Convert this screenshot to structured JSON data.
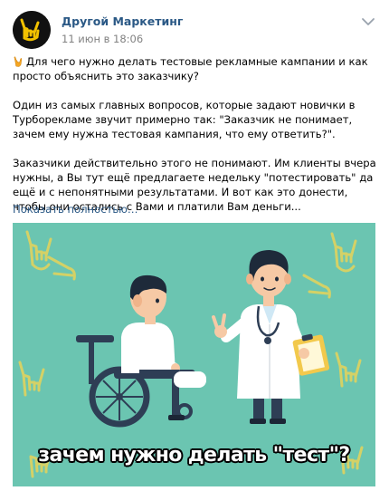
{
  "post": {
    "author": "Другой Маркетинг",
    "date": "11 июн в 18:06",
    "paragraphs": [
      "Для чего нужно делать тестовые рекламные кампании и как просто объяснить это заказчику?",
      "Один из самых главных вопросов, которые задают новички в Турборекламе звучит примерно так: \"Заказчик не понимает, зачем ему нужна тестовая кампания, что ему ответить?\".",
      "Заказчики действительно этого не понимают. Им клиенты вчера нужны, а Вы тут ещё предлагаете недельку \"потестировать\" да ещё и с непонятными результатами. И вот как это донести, чтобы они остались с Вами и платили Вам деньги..."
    ],
    "show_more": "Показать полностью…",
    "image_caption": "зачем нужно делать \"тест\"?"
  },
  "colors": {
    "link": "#2a5885",
    "muted": "#828282",
    "image_bg": "#6bc5b1",
    "doctor_coat": "#ffffff",
    "hair": "#1e2a3a"
  },
  "icons": [
    "rock-hand-avatar-icon",
    "rock-hand-emoji-icon",
    "chevron-down-icon",
    "rock-hand-doodle-icon"
  ]
}
